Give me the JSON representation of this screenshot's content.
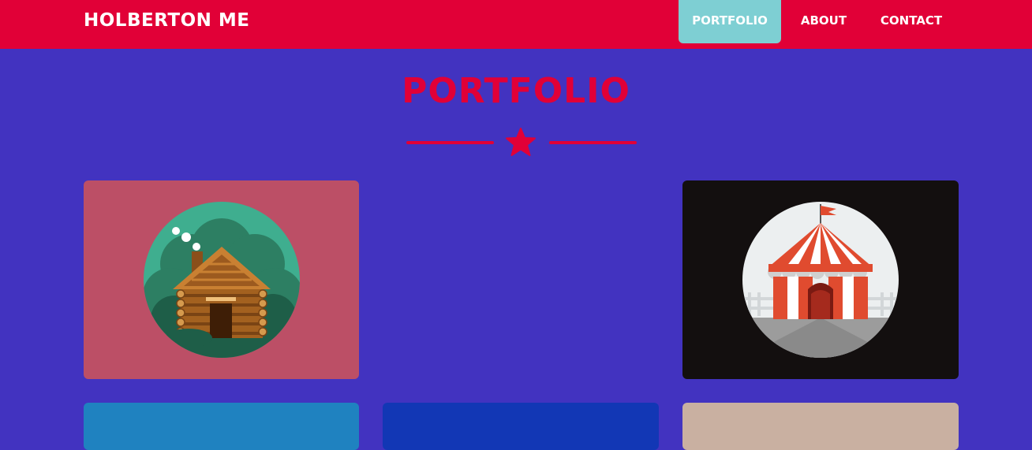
{
  "header": {
    "brand": "HOLBERTON ME",
    "nav": [
      {
        "label": "PORTFOLIO",
        "active": true
      },
      {
        "label": "ABOUT",
        "active": false
      },
      {
        "label": "CONTACT",
        "active": false
      }
    ]
  },
  "portfolio": {
    "title": "PORTFOLIO",
    "divider_icon": "star-icon",
    "cards": [
      {
        "icon": "log-cabin-icon",
        "background": "#bc4f66"
      },
      {
        "icon": "circus-tent-icon",
        "background": "#130f0f"
      },
      {
        "background": "#1f82c0"
      },
      {
        "background": "#1237b5"
      },
      {
        "background": "#c9b0a1"
      }
    ]
  },
  "colors": {
    "page_background": "#4233c0",
    "navbar": "#e10037",
    "nav_active": "#7ecfd3",
    "accent": "#e10037"
  }
}
